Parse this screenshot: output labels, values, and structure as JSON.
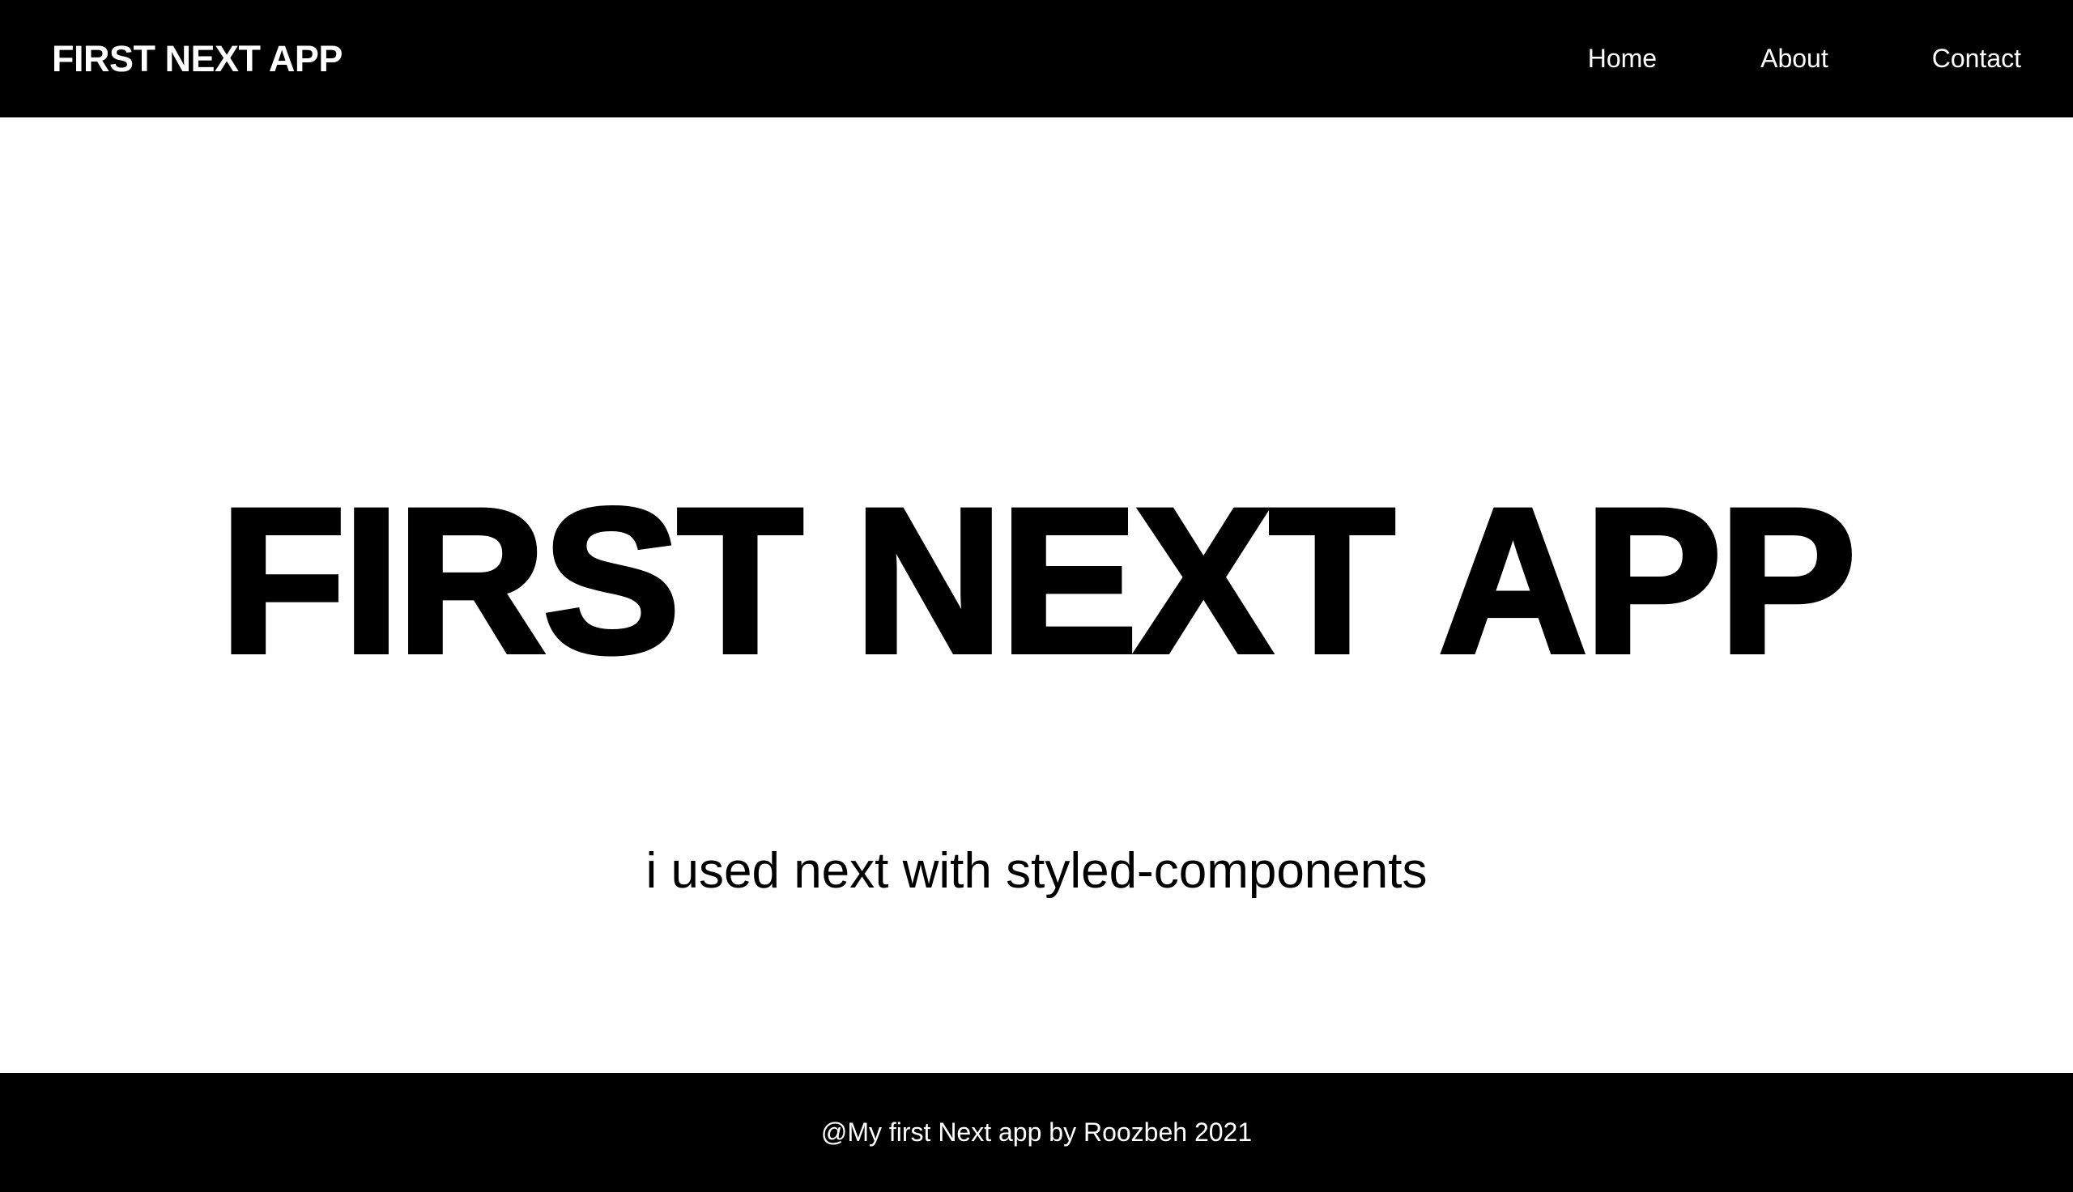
{
  "navbar": {
    "brand": "FIRST NEXT APP",
    "links": [
      {
        "label": "Home"
      },
      {
        "label": "About"
      },
      {
        "label": "Contact"
      }
    ]
  },
  "hero": {
    "title": "FIRST NEXT APP",
    "subtitle": "i used next with styled-components"
  },
  "footer": {
    "text": "@My first Next app by Roozbeh 2021"
  },
  "colors": {
    "background": "#ffffff",
    "bars": "#000000",
    "bar_text": "#ffffff",
    "text": "#000000"
  }
}
